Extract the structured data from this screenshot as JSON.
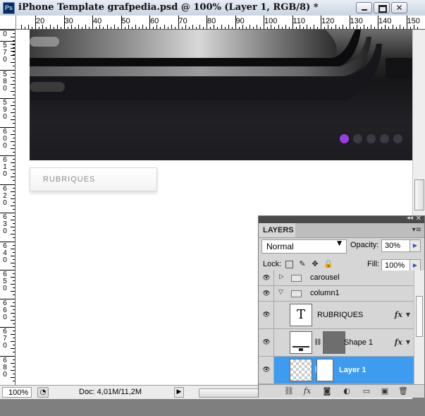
{
  "window": {
    "title": "iPhone Template grafpedia.psd @ 100% (Layer 1, RGB/8) *",
    "app_icon": "Ps",
    "minimize_icon": "minimize-icon",
    "maximize_icon": "maximize-icon",
    "close_label": "✕"
  },
  "ruler": {
    "horizontal_labels": [
      "20",
      "30",
      "40",
      "50",
      "60",
      "70",
      "80",
      "90",
      "100",
      "110",
      "120",
      "130",
      "140",
      "150"
    ],
    "vertical_labels": [
      "0",
      "570",
      "580",
      "590",
      "600",
      "610",
      "620",
      "630",
      "640",
      "650",
      "660",
      "670",
      "680"
    ]
  },
  "canvas": {
    "carousel_dots": 5,
    "active_dot": 0,
    "active_color": "#9b3be0",
    "button_label": "RUBRIQUES"
  },
  "status": {
    "zoom": "100%",
    "doc": "Doc: 4,01M/11,2M"
  },
  "layers_panel": {
    "tab": "LAYERS",
    "blend_mode": "Normal",
    "opacity_label": "Opacity:",
    "opacity_value": "30%",
    "lock_label": "Lock:",
    "fill_label": "Fill:",
    "fill_value": "100%",
    "layers": [
      {
        "name": "carousel",
        "type": "group",
        "expanded": false
      },
      {
        "name": "column1",
        "type": "group",
        "expanded": true
      },
      {
        "name": "RUBRIQUES",
        "type": "text",
        "thumb": "T",
        "fx": "fx"
      },
      {
        "name": "Shape 1",
        "type": "shape",
        "fx": "fx"
      },
      {
        "name": "Layer 1",
        "type": "pixel",
        "selected": true
      }
    ]
  }
}
